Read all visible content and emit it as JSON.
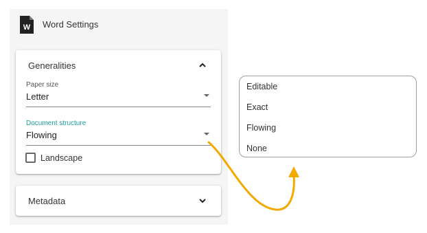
{
  "header": {
    "title": "Word Settings",
    "icon": "word-document-icon"
  },
  "generalities": {
    "title": "Generalities",
    "paper_size": {
      "label": "Paper size",
      "value": "Letter"
    },
    "document_structure": {
      "label": "Document structure",
      "value": "Flowing"
    },
    "landscape": {
      "label": "Landscape",
      "checked": false
    }
  },
  "metadata": {
    "title": "Metadata"
  },
  "dropdown": {
    "options": [
      "Editable",
      "Exact",
      "Flowing",
      "None"
    ]
  },
  "colors": {
    "accent": "#1a9fa0",
    "arrow": "#f2a900"
  }
}
